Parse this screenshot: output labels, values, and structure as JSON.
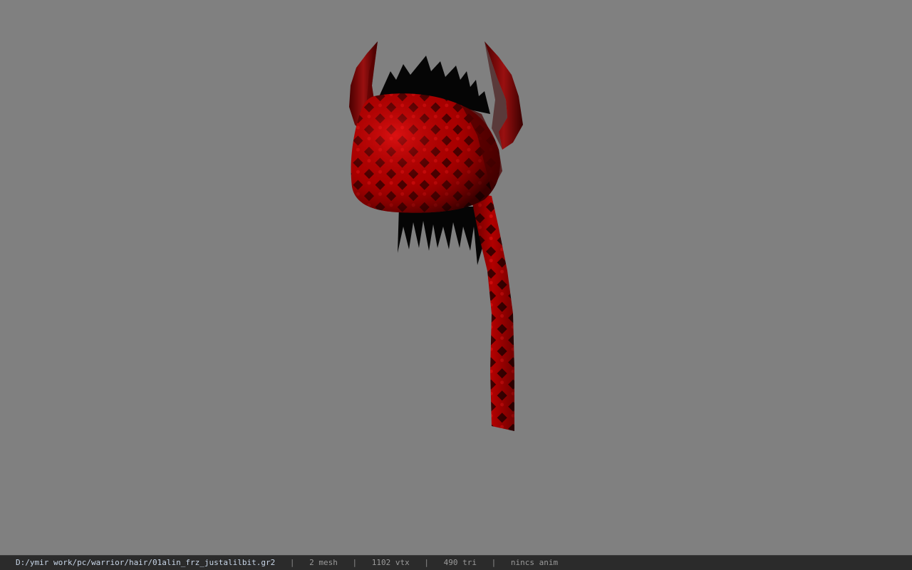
{
  "statusbar": {
    "file_path": "D:/ymir work/pc/warrior/hair/01alin_frz_justalilbit.gr2",
    "separator": "|",
    "mesh_count": "2 mesh",
    "vertex_count": "1102 vtx",
    "triangle_count": "490 tri",
    "animation": "nincs anim"
  },
  "viewport": {
    "background_color": "#808080",
    "model": "hair-mesh-with-horns"
  },
  "colors": {
    "cap_red": "#c80000",
    "cap_dark": "#3a0000",
    "horn_red": "#8a0a0a",
    "spikes": "#050505"
  }
}
